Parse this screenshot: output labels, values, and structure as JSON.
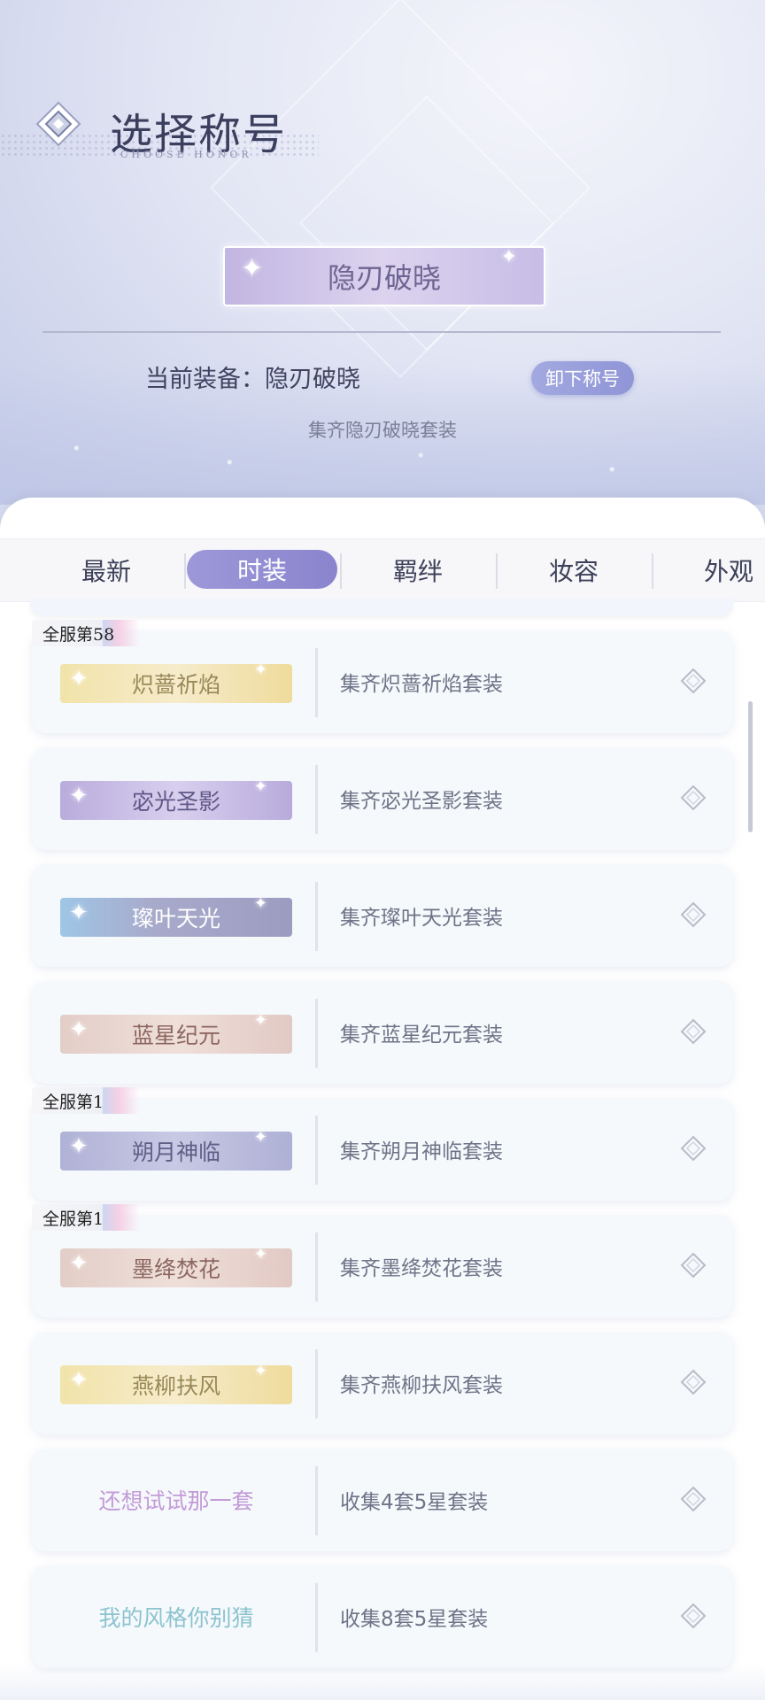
{
  "header": {
    "title": "选择称号",
    "subtitle": "CHOOSE HONOR"
  },
  "current": {
    "badge_label": "隐刃破晓",
    "equip_label": "当前装备：隐刃破晓",
    "unequip_button": "卸下称号",
    "description": "集齐隐刃破晓套装"
  },
  "tabs": [
    {
      "label": "最新",
      "active": false
    },
    {
      "label": "时装",
      "active": true
    },
    {
      "label": "羁绊",
      "active": false
    },
    {
      "label": "妆容",
      "active": false
    },
    {
      "label": "外观",
      "active": false
    }
  ],
  "titles": [
    {
      "rank": "全服第58",
      "label": "炽蔷祈焰",
      "description": "集齐炽蔷祈焰套装",
      "style": "gold",
      "icon": "diamond-icon"
    },
    {
      "rank": "",
      "label": "宓光圣影",
      "description": "集齐宓光圣影套装",
      "style": "violet",
      "icon": "diamond-icon"
    },
    {
      "rank": "",
      "label": "璨叶天光",
      "description": "集齐璨叶天光套装",
      "style": "steel",
      "icon": "diamond-icon"
    },
    {
      "rank": "",
      "label": "蓝星纪元",
      "description": "集齐蓝星纪元套装",
      "style": "rose",
      "icon": "diamond-icon"
    },
    {
      "rank": "全服第1",
      "label": "朔月神临",
      "description": "集齐朔月神临套装",
      "style": "lavender",
      "icon": "diamond-icon"
    },
    {
      "rank": "全服第1",
      "label": "墨绛焚花",
      "description": "集齐墨绛焚花套装",
      "style": "rose",
      "icon": "diamond-icon"
    },
    {
      "rank": "",
      "label": "燕柳扶风",
      "description": "集齐燕柳扶风套装",
      "style": "gold",
      "icon": "diamond-icon"
    },
    {
      "rank": "",
      "label": "还想试试那一套",
      "description": "收集4套5星套装",
      "style": "text-pink",
      "icon": "diamond-icon"
    },
    {
      "rank": "",
      "label": "我的风格你别猜",
      "description": "收集8套5星套装",
      "style": "text-teal",
      "icon": "diamond-icon"
    }
  ],
  "colors": {
    "accent": "#8f95d6",
    "tab_active": "#8a84ce"
  }
}
